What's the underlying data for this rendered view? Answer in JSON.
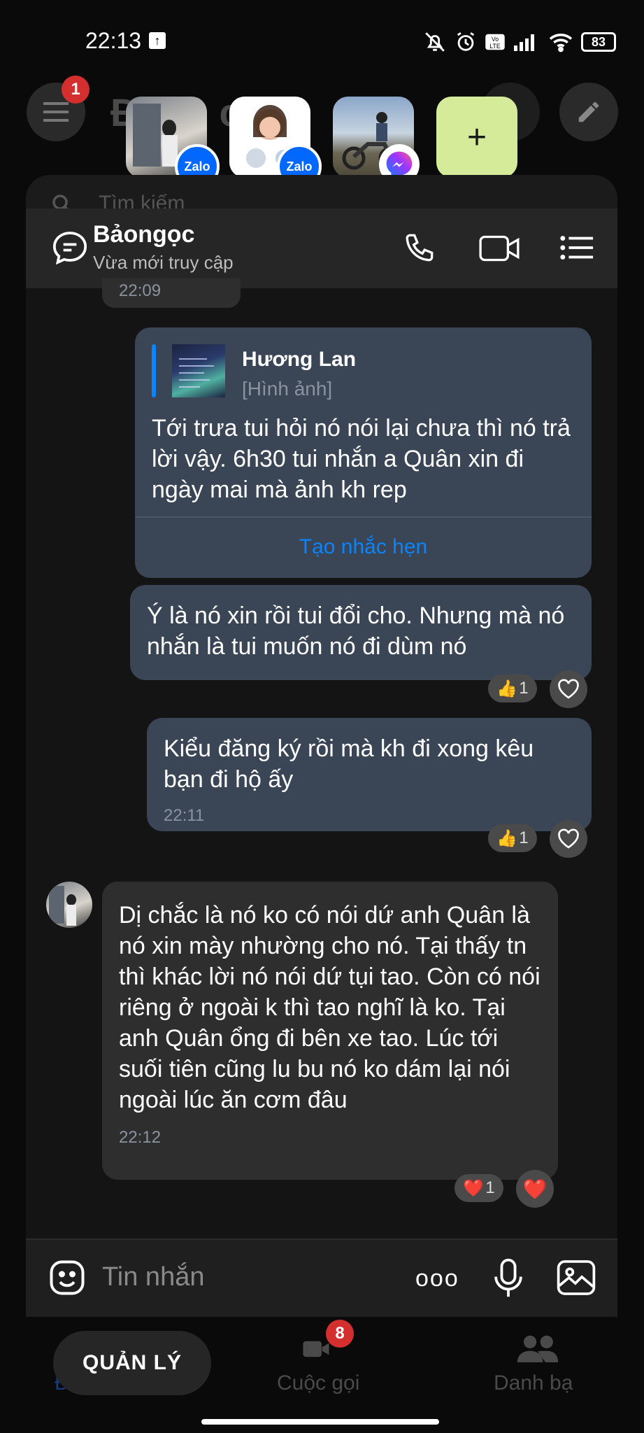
{
  "status": {
    "time": "22:13",
    "battery": "83",
    "upload_glyph": "↑"
  },
  "background_app": {
    "menu_badge": "1",
    "title_partial": "Đoạn c",
    "search_placeholder": "Tìm kiếm",
    "nav": [
      {
        "label": "Đoạn chat",
        "badge": ""
      },
      {
        "label": "Cuộc gọi",
        "badge": "8"
      },
      {
        "label": "Danh bạ",
        "badge": ""
      }
    ]
  },
  "chat_heads": [
    {
      "app": "Zalo"
    },
    {
      "app": "Zalo"
    },
    {
      "app": "Messenger"
    }
  ],
  "add_button": "+",
  "chat": {
    "contact_name": "Bảongọc",
    "contact_status": "Vừa mới truy cập",
    "partial_time": "22:09",
    "messages": [
      {
        "quote_author": "Hương Lan",
        "quote_type": "[Hình ảnh]",
        "text": "Tới trưa tui hỏi nó nói lại chưa thì nó trả lời vậy. 6h30 tui nhắn a Quân xin đi ngày mai mà ảnh kh rep",
        "action": "Tạo nhắc hẹn"
      },
      {
        "text": "Ý là nó xin rồi tui đổi cho. Nhưng mà nó nhắn là tui muốn nó đi dùm nó",
        "reaction_emoji": "👍",
        "reaction_count": "1"
      },
      {
        "text": "Kiểu đăng ký rồi mà kh đi xong kêu bạn đi hộ ấy",
        "time": "22:11",
        "reaction_emoji": "👍",
        "reaction_count": "1"
      },
      {
        "text": "Dị chắc là nó ko có nói dứ anh Quân là nó xin mày nhường cho nó. Tại thấy tn thì khác lời nó nói dứ tụi tao. Còn có nói riêng ở ngoài k thì tao nghĩ là ko. Tại anh Quân ổng đi bên xe tao. Lúc tới suối tiên cũng lu bu nó ko dám lại nói ngoài lúc ăn cơm đâu",
        "time": "22:12",
        "reaction_emoji": "❤️",
        "reaction_count": "1",
        "quick_react": "❤️"
      }
    ]
  },
  "input": {
    "placeholder": "Tin nhắn",
    "more": "ooo"
  },
  "manage_button": "QUẢN LÝ",
  "colors": {
    "accent_blue": "#0a84ff",
    "bubble_out": "#3a4556",
    "bubble_in": "#2e2e2e",
    "add_tile": "#d5eb9a"
  }
}
